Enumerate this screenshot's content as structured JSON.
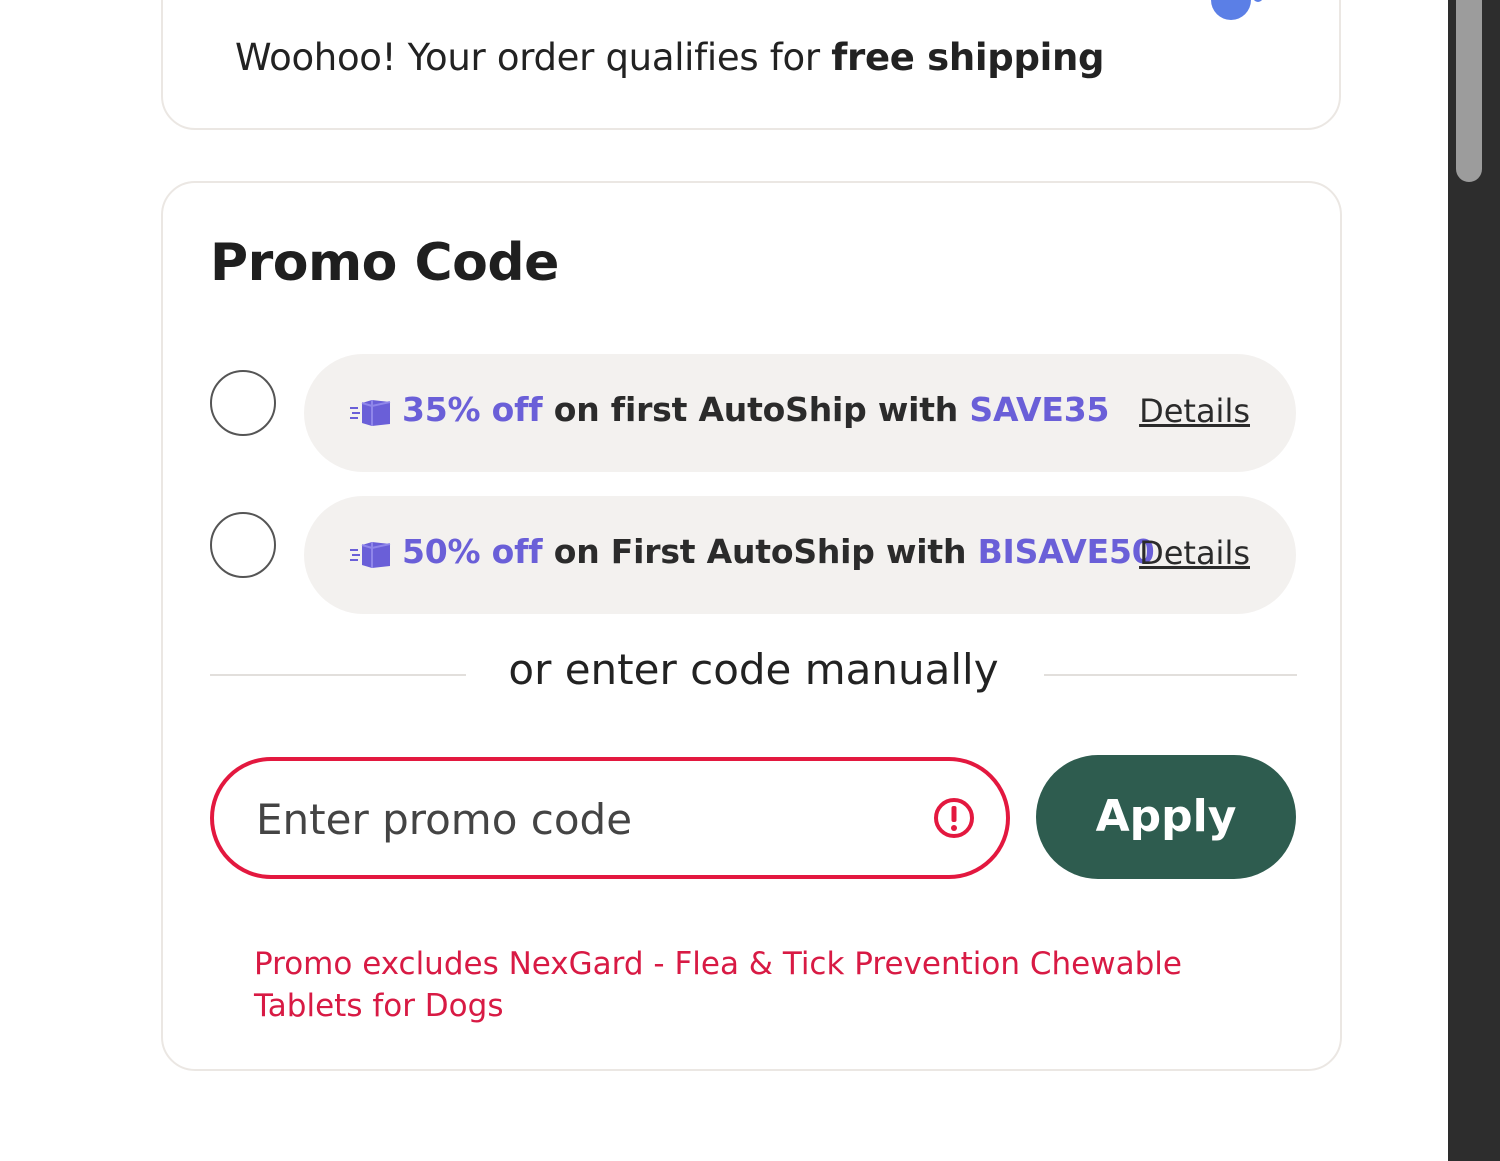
{
  "shipping": {
    "message_prefix": "Woohoo! Your order qualifies for ",
    "message_bold": "free shipping"
  },
  "promo": {
    "title": "Promo Code",
    "offers": [
      {
        "discount": "35% off",
        "middle": " on first AutoShip with ",
        "code": "SAVE35",
        "details_label": "Details",
        "icon": "autoship-truck-icon"
      },
      {
        "discount": "50% off",
        "middle": " on First AutoShip with ",
        "code": "BISAVE50",
        "details_label": "Details",
        "icon": "autoship-truck-icon"
      }
    ],
    "divider_text": "or enter code manually",
    "input": {
      "placeholder": "Enter promo code",
      "value": ""
    },
    "apply_label": "Apply",
    "error_message": "Promo excludes NexGard - Flea & Tick Prevention Chewable Tablets for Dogs"
  },
  "colors": {
    "accent": "#6a5fd8",
    "apply_button": "#2e5c4f",
    "error": "#e3183f",
    "pill_background": "#f3f1ef"
  }
}
